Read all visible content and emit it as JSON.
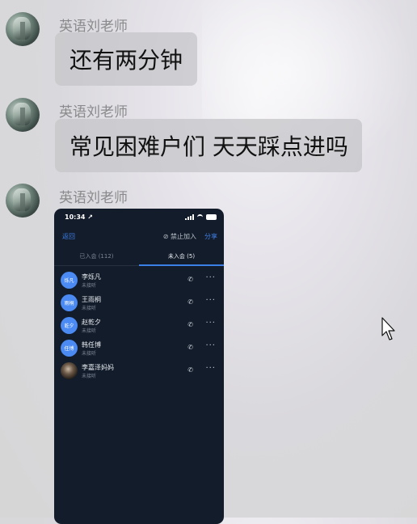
{
  "messages": [
    {
      "sender": "英语刘老师",
      "text": "还有两分钟"
    },
    {
      "sender": "英语刘老师",
      "text": "常见困难户们 天天踩点进吗"
    },
    {
      "sender": "英语刘老师"
    }
  ],
  "phone": {
    "time": "10:34 ↗",
    "nav": {
      "back": "返回",
      "ban": "禁止加入",
      "share": "分享"
    },
    "tabs": [
      {
        "label": "已入会 (112)"
      },
      {
        "label": "未入会 (5)"
      }
    ],
    "members": [
      {
        "avatar_text": "烁凡",
        "name": "李烁凡",
        "status": "未接听"
      },
      {
        "avatar_text": "雨桐",
        "name": "王雨桐",
        "status": "未接听"
      },
      {
        "avatar_text": "乾夕",
        "name": "赵乾夕",
        "status": "未接听"
      },
      {
        "avatar_text": "任博",
        "name": "韩任博",
        "status": "未接听"
      },
      {
        "avatar_text": "",
        "name": "李嘉泽妈妈",
        "status": "未接听"
      }
    ],
    "icons": {
      "call": "phone-icon",
      "more": "more-icon"
    }
  },
  "colors": {
    "accent": "#3b7fe6",
    "avatar_blue": "#4b8af2",
    "phone_bg": "#131c2a"
  }
}
